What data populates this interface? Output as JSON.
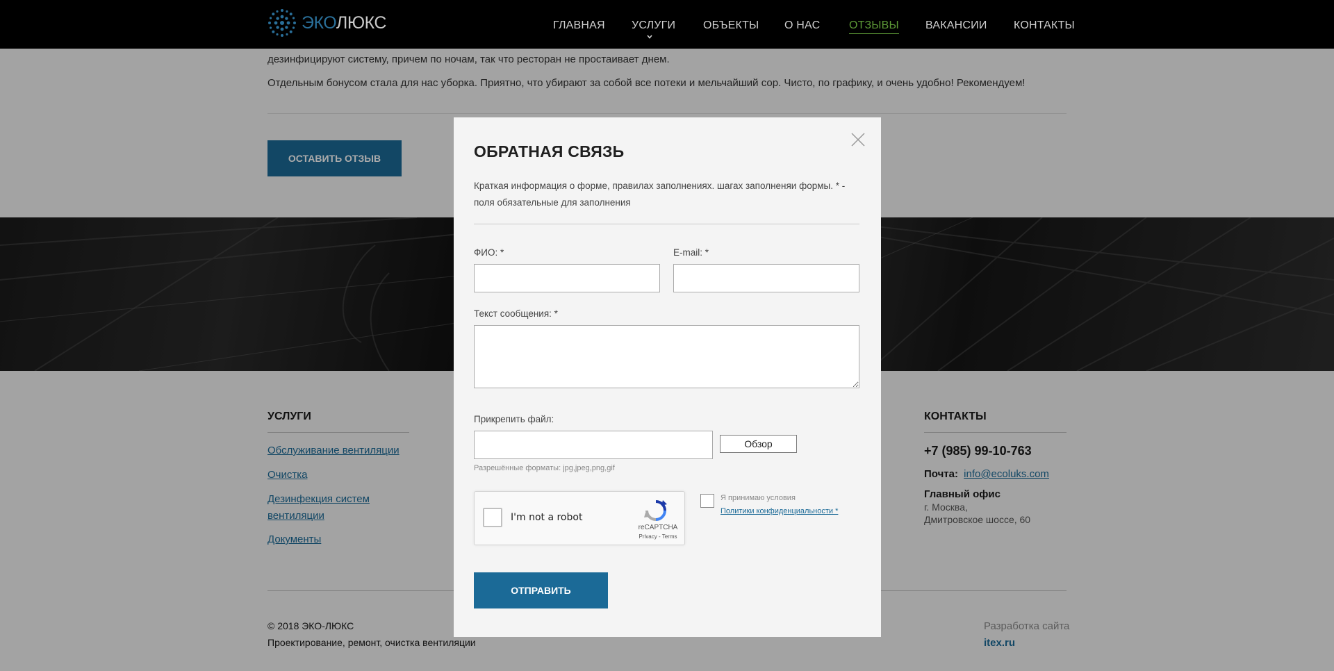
{
  "header": {
    "logo_eko": "ЭКО",
    "logo_lux": "ЛЮКС",
    "nav": [
      "ГЛАВНАЯ",
      "УСЛУГИ",
      "ОБЪЕКТЫ",
      "О НАС",
      "ОТЗЫВЫ",
      "ВАКАНСИИ",
      "КОНТАКТЫ"
    ],
    "active_nav": "ОТЗЫВЫ"
  },
  "review": {
    "line1": "дезинфицируют систему, причем по ночам, так что ресторан не простаивает днем.",
    "line2": "Отдельным бонусом стала для нас уборка. Приятно, что убирают за собой все потеки и мельчайший сор. Чисто, по графику, и очень удобно! Рекомендуем!",
    "leave_review_button": "ОСТАВИТЬ ОТЗЫВ"
  },
  "footer": {
    "services_heading": "УСЛУГИ",
    "services": [
      "Обслуживание вентиляции",
      "Очистка",
      "Дезинфекция систем",
      "вентиляции",
      "Документы"
    ],
    "contacts_heading": "КОНТАКТЫ",
    "phone": "+7 (985) 99-10-763",
    "mail_label": "Почта:",
    "mail_value": "info@ecoluks.com",
    "office_title": "Главный офис",
    "office_city": "г. Москва,",
    "office_address": "Дмитровское шоссе, 60",
    "copyright": "© 2018 ЭКО-ЛЮКС",
    "tagline": "Проектирование, ремонт, очистка вентиляции",
    "dev_label": "Разработка сайта",
    "dev_link": "itex.ru"
  },
  "modal": {
    "title": "ОБРАТНАЯ СВЯЗЬ",
    "description": "Краткая информация о форме, правилах заполнениях. шагах заполненяи формы. * - поля обязательные для заполнения",
    "fio_label": "ФИО: *",
    "fio_value": "",
    "email_label": "E-mail: *",
    "email_value": "",
    "message_label": "Текст сообщения: *",
    "message_value": "",
    "file_label": "Прикрепить файл:",
    "file_value": "",
    "browse_button": "Обзор",
    "formats": "Разрешённые форматы: jpg,jpeg,png,gif",
    "captcha_text": "I'm not a robot",
    "captcha_brand": "reCAPTCHA",
    "captcha_terms": "Privacy - Terms",
    "agree_text": "Я принимаю условия",
    "agree_link": "Политики конфиденциальности *",
    "submit_button": "ОТПРАВИТЬ"
  },
  "colors": {
    "accent_blue": "#1b6a97",
    "active_green": "#5d9a37",
    "header_bg": "#000000"
  },
  "icons": [
    "logo-mark-icon",
    "chevron-down-icon",
    "close-icon",
    "recaptcha-icon"
  ]
}
